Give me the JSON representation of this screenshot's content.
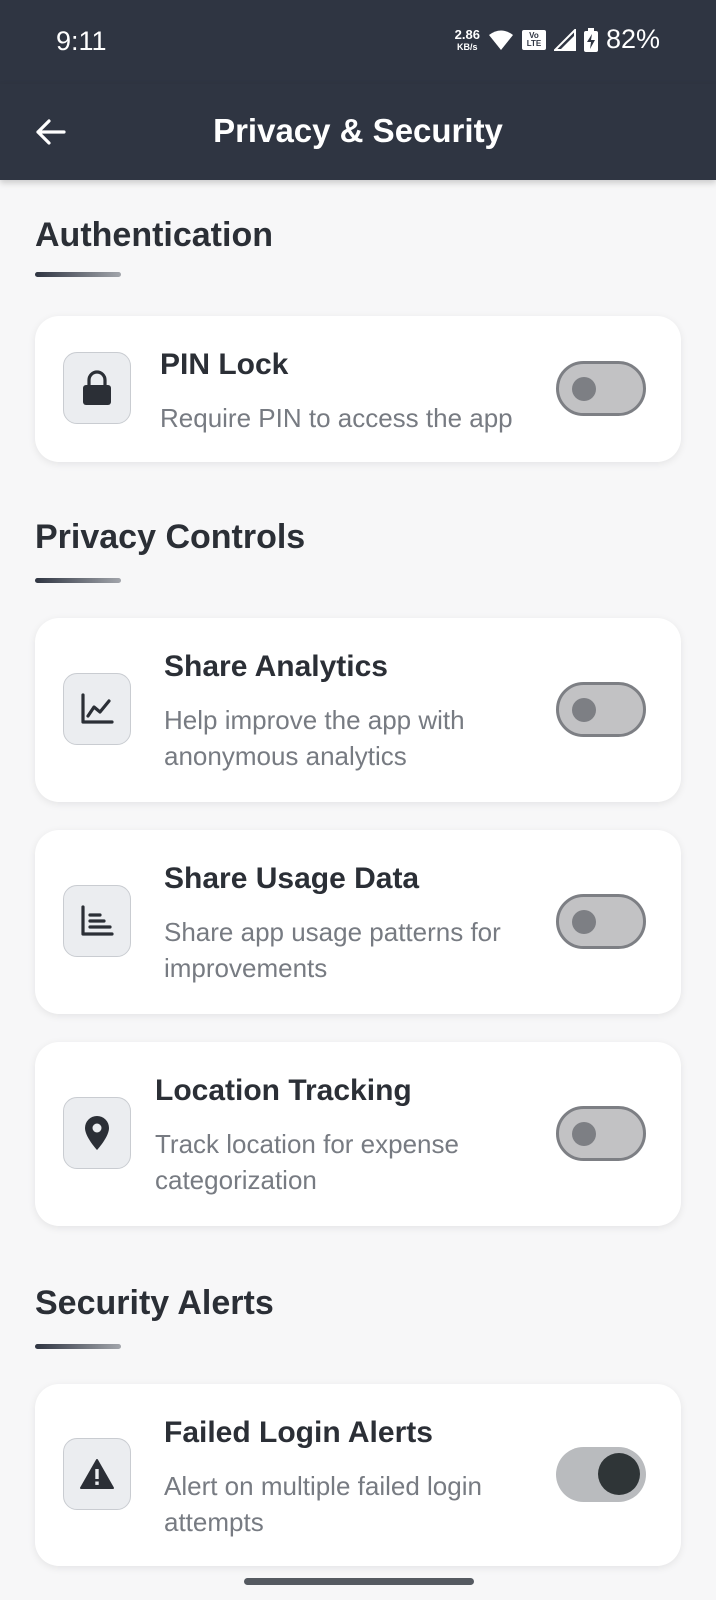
{
  "status_bar": {
    "time": "9:11",
    "net_speed": "2.86",
    "net_unit": "KB/s",
    "volte_top": "Vo",
    "volte_bottom": "LTE",
    "battery": "82%"
  },
  "header": {
    "title": "Privacy & Security"
  },
  "sections": [
    {
      "title": "Authentication",
      "items": [
        {
          "title": "PIN Lock",
          "description": "Require PIN to access the app",
          "icon": "lock-icon",
          "enabled": false
        }
      ]
    },
    {
      "title": "Privacy Controls",
      "items": [
        {
          "title": "Share Analytics",
          "description": "Help improve the app with anonymous analytics",
          "icon": "chart-icon",
          "enabled": false
        },
        {
          "title": "Share Usage Data",
          "description": "Share app usage patterns for improvements",
          "icon": "list-chart-icon",
          "enabled": false
        },
        {
          "title": "Location Tracking",
          "description": "Track location for expense categorization",
          "icon": "location-pin-icon",
          "enabled": false
        }
      ]
    },
    {
      "title": "Security Alerts",
      "items": [
        {
          "title": "Failed Login Alerts",
          "description": "Alert on multiple failed login attempts",
          "icon": "warning-icon",
          "enabled": true
        }
      ]
    }
  ],
  "colors": {
    "header_bg": "#2f3542",
    "page_bg": "#f7f7f8",
    "card_bg": "#ffffff",
    "toggle_on_knob": "#2f3537"
  }
}
